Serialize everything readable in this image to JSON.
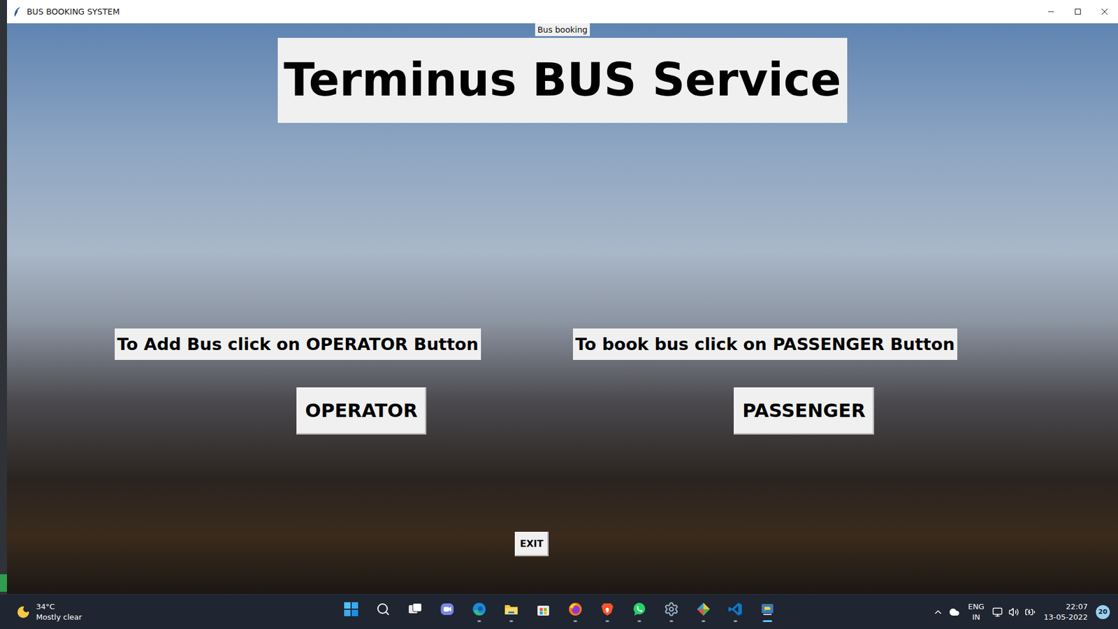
{
  "window": {
    "title": "BUS BOOKING SYSTEM"
  },
  "header": {
    "caption": "Bus booking",
    "title": "Terminus BUS Service"
  },
  "panels": [
    {
      "hint": "To Add Bus click on OPERATOR Button",
      "button": "OPERATOR"
    },
    {
      "hint": "To book bus click on PASSENGER Button",
      "button": "PASSENGER"
    }
  ],
  "exit_button": "EXIT",
  "taskbar": {
    "weather": {
      "temperature": "34°C",
      "condition": "Mostly clear"
    },
    "apps": [
      {
        "running": false,
        "active": false
      },
      {
        "running": false,
        "active": false
      },
      {
        "running": false,
        "active": false
      },
      {
        "running": false,
        "active": false
      },
      {
        "running": true,
        "active": false
      },
      {
        "running": true,
        "active": false
      },
      {
        "running": false,
        "active": false
      },
      {
        "running": true,
        "active": false
      },
      {
        "running": true,
        "active": false
      },
      {
        "running": true,
        "active": false
      },
      {
        "running": true,
        "active": false
      },
      {
        "running": true,
        "active": false
      },
      {
        "running": true,
        "active": false
      },
      {
        "running": true,
        "active": true
      }
    ],
    "tray": {
      "language": "ENG",
      "region": "IN",
      "time": "22:07",
      "date": "13-05-2022",
      "notifications": "20"
    }
  }
}
